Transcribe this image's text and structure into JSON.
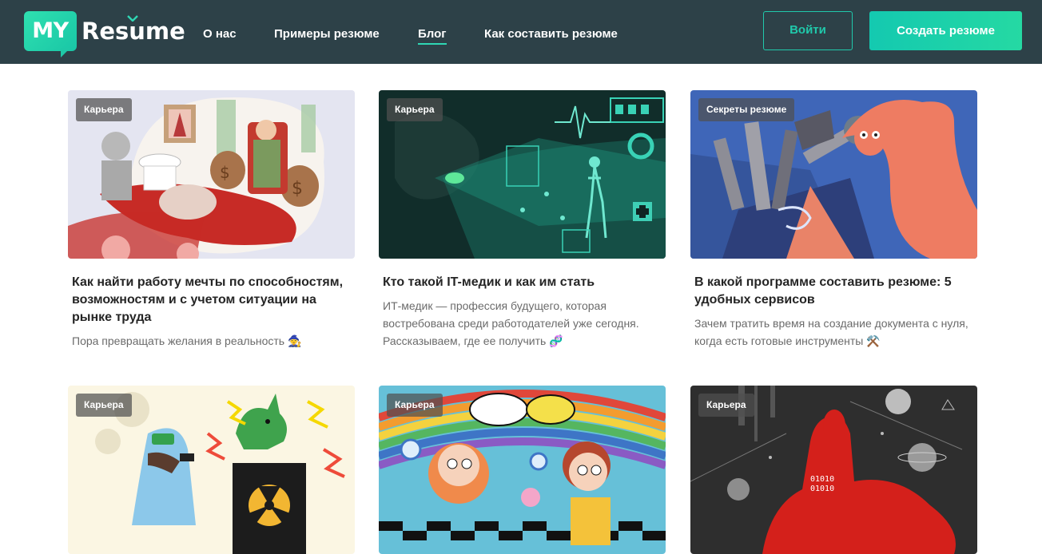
{
  "header": {
    "logo": {
      "badge_text": "MY",
      "word_text": "Resume"
    },
    "nav": [
      {
        "label": "О нас",
        "active": false
      },
      {
        "label": "Примеры резюме",
        "active": false
      },
      {
        "label": "Блог",
        "active": true
      },
      {
        "label": "Как составить резюме",
        "active": false
      }
    ],
    "login_label": "Войти",
    "create_label": "Создать резюме"
  },
  "colors": {
    "header_bg": "#2d4148",
    "accent": "#20c9ab"
  },
  "articles": [
    {
      "category": "Карьера",
      "title": "Как найти работу мечты по способностям, возможностям и с учетом ситуации на рынке труда",
      "description": "Пора превращать желания в реальность 🧙"
    },
    {
      "category": "Карьера",
      "title": "Кто такой IT-медик и как им стать",
      "description": "ИТ-медик — профессия будущего, которая востребована среди работодателей уже сегодня. Рассказываем, где ее получить 🧬"
    },
    {
      "category": "Секреты резюме",
      "title": "В какой программе составить резюме: 5 удобных сервисов",
      "description": "Зачем тратить время на создание документа с нуля, когда есть готовые инструменты ⚒️"
    },
    {
      "category": "Карьера"
    },
    {
      "category": "Карьера"
    },
    {
      "category": "Карьера"
    }
  ]
}
